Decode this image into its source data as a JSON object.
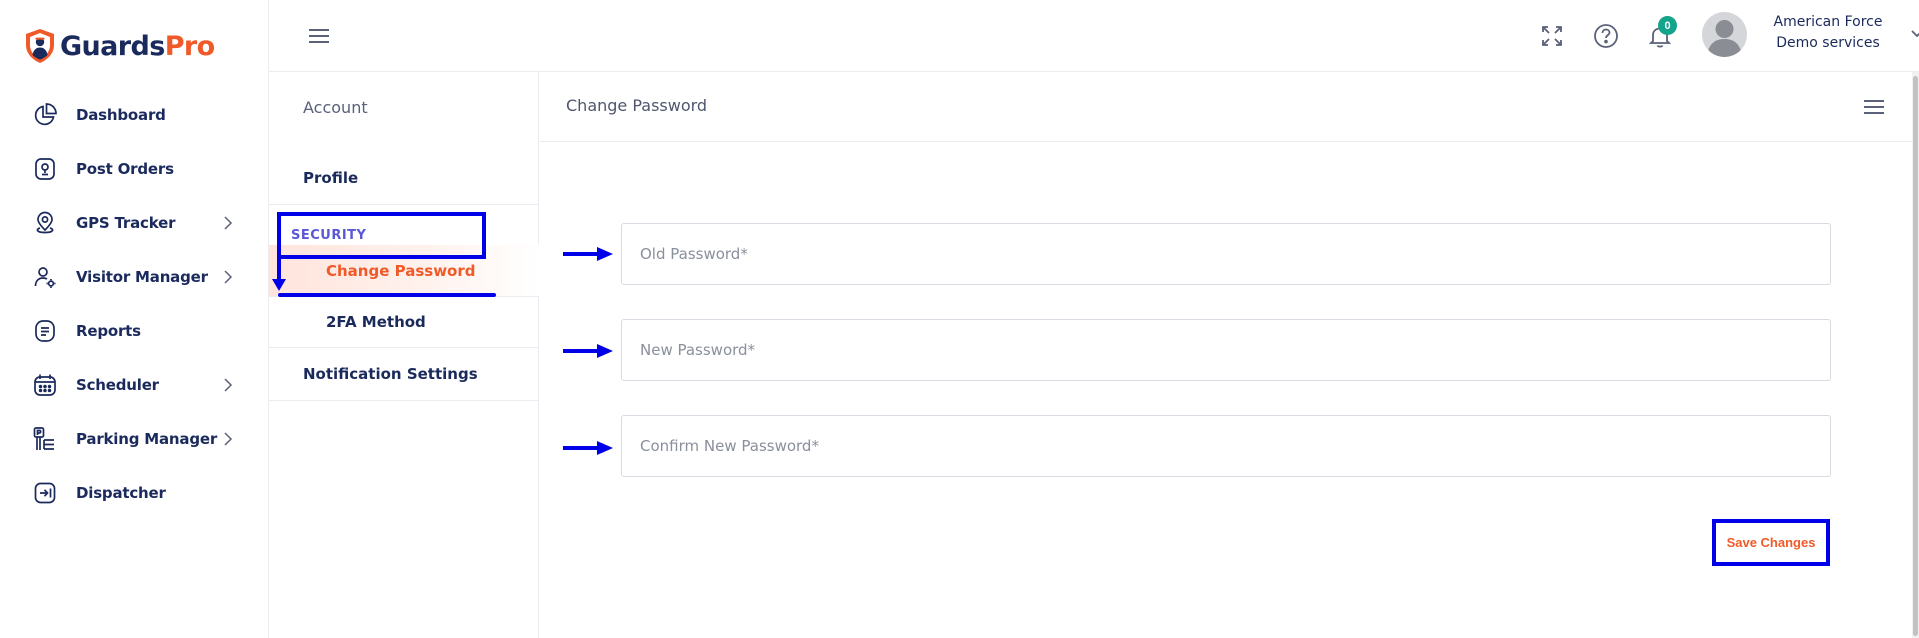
{
  "brand": {
    "name_part1": "Guards",
    "name_part2": "Pro",
    "primary": "#1b2a5c",
    "accent": "#f05a28"
  },
  "sidebar": {
    "items": [
      {
        "label": "Dashboard",
        "icon": "pie-chart-icon",
        "has_submenu": false
      },
      {
        "label": "Post Orders",
        "icon": "badge-icon",
        "has_submenu": false
      },
      {
        "label": "GPS Tracker",
        "icon": "map-pin-icon",
        "has_submenu": true
      },
      {
        "label": "Visitor Manager",
        "icon": "user-gear-icon",
        "has_submenu": true
      },
      {
        "label": "Reports",
        "icon": "report-icon",
        "has_submenu": false
      },
      {
        "label": "Scheduler",
        "icon": "calendar-icon",
        "has_submenu": true
      },
      {
        "label": "Parking Manager",
        "icon": "parking-icon",
        "has_submenu": true
      },
      {
        "label": "Dispatcher",
        "icon": "dispatch-icon",
        "has_submenu": false
      }
    ]
  },
  "topbar": {
    "notifications_count": "0",
    "user_name": "American Force",
    "user_org": "Demo services"
  },
  "settings_menu": {
    "heading": "Account",
    "profile": "Profile",
    "security_section": "SECURITY",
    "change_password": "Change Password",
    "twofa": "2FA Method",
    "notification_settings": "Notification Settings"
  },
  "main": {
    "title": "Change Password",
    "fields": {
      "old_password_placeholder": "Old Password*",
      "new_password_placeholder": "New Password*",
      "confirm_password_placeholder": "Confirm New Password*"
    },
    "save_label": "Save Changes"
  },
  "annotation_color": "#0000e8"
}
